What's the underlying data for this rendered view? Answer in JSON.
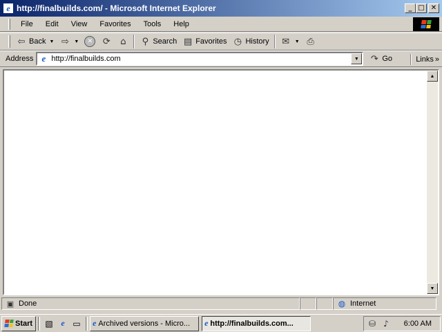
{
  "window": {
    "title": "http://finalbuilds.com/ - Microsoft Internet Explorer"
  },
  "menu": [
    "File",
    "Edit",
    "View",
    "Favorites",
    "Tools",
    "Help"
  ],
  "toolbar": {
    "back_label": "Back",
    "search_label": "Search",
    "favorites_label": "Favorites",
    "history_label": "History"
  },
  "address": {
    "label": "Address",
    "value": "http://finalbuilds.com",
    "go_label": "Go",
    "links_label": "Links"
  },
  "status": {
    "text": "Done",
    "zone": "Internet"
  },
  "taskbar": {
    "start_label": "Start",
    "tasks": [
      {
        "label": "Archived versions - Micro..."
      },
      {
        "label": "http://finalbuilds.com..."
      }
    ],
    "clock": "6:00 AM"
  },
  "colors": {
    "title_start": "#0a246a",
    "title_end": "#a6caf0",
    "chrome": "#d4d0c8"
  }
}
